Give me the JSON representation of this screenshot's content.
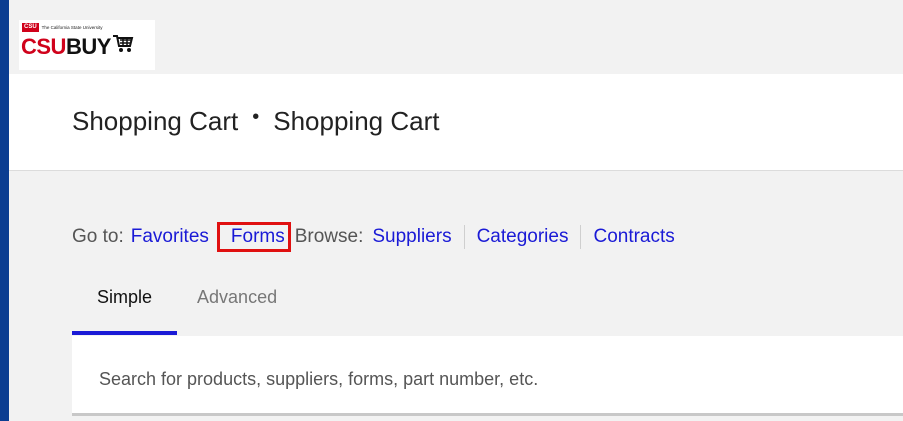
{
  "logo": {
    "badge": "CSU",
    "university": "The California State University",
    "wordmark_csu": "CSU",
    "wordmark_buy": "BUY",
    "cart_icon": "shopping-cart-icon"
  },
  "page": {
    "breadcrumb_first": "Shopping Cart",
    "breadcrumb_separator": "•",
    "breadcrumb_second": "Shopping Cart"
  },
  "nav": {
    "goto_label": "Go to:",
    "favorites": "Favorites",
    "forms": "Forms",
    "browse_label": "Browse:",
    "suppliers": "Suppliers",
    "categories": "Categories",
    "contracts": "Contracts"
  },
  "tabs": [
    {
      "label": "Simple",
      "active": true
    },
    {
      "label": "Advanced",
      "active": false
    }
  ],
  "search": {
    "placeholder": "Search for products, suppliers, forms, part number, etc.",
    "value": ""
  },
  "colors": {
    "accent_link": "#1a1ad6",
    "brand_red": "#d0021b",
    "left_bar": "#0b3d91",
    "highlight_border": "#e01010"
  }
}
